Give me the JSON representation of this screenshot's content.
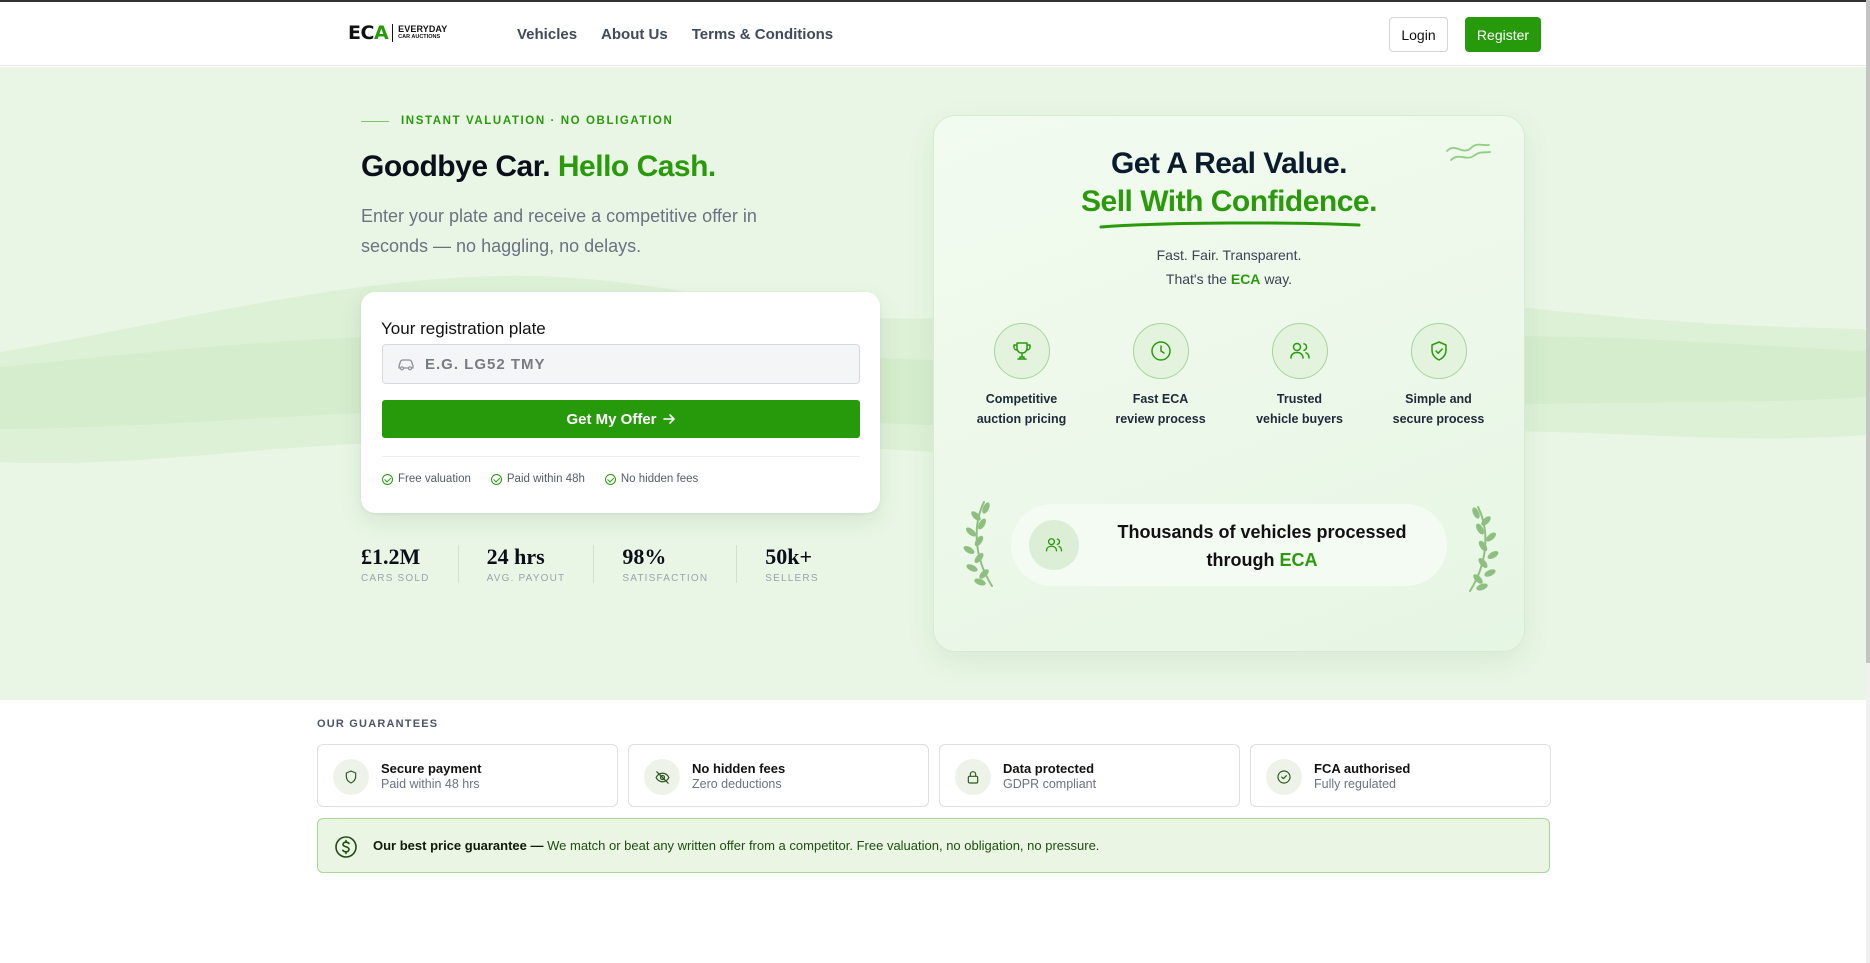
{
  "header": {
    "logo_mark_1": "EC",
    "logo_mark_2": "A",
    "logo_line1": "EVERYDAY",
    "logo_line2": "CAR AUCTIONS",
    "nav": [
      "Vehicles",
      "About Us",
      "Terms & Conditions"
    ],
    "login_label": "Login",
    "register_label": "Register"
  },
  "hero": {
    "eyebrow": "INSTANT VALUATION · NO OBLIGATION",
    "title_part1": "Goodbye Car.",
    "title_part2": "Hello Cash.",
    "subtitle": "Enter your plate and receive a competitive offer in seconds — no haggling, no delays.",
    "plate_label": "Your registration plate",
    "plate_placeholder": "E.G. LG52 TMY",
    "plate_value": "",
    "offer_button": "Get My Offer",
    "perks": [
      "Free valuation",
      "Paid within 48h",
      "No hidden fees"
    ],
    "stats": [
      {
        "value": "£1.2M",
        "label": "CARS SOLD"
      },
      {
        "value": "24 hrs",
        "label": "AVG. PAYOUT"
      },
      {
        "value": "98%",
        "label": "SATISFACTION"
      },
      {
        "value": "50k+",
        "label": "SELLERS"
      }
    ]
  },
  "value_card": {
    "title_line1": "Get A Real Value.",
    "title_line2": "Sell With Confidence.",
    "sub_line1": "Fast. Fair. Transparent.",
    "sub_line2_pre": "That's the",
    "sub_line2_brand": "ECA",
    "sub_line2_post": "way.",
    "features": [
      {
        "icon": "trophy-icon",
        "line1": "Competitive",
        "line2": "auction pricing"
      },
      {
        "icon": "clock-icon",
        "line1": "Fast ECA",
        "line2": "review process"
      },
      {
        "icon": "users-icon",
        "line1": "Trusted",
        "line2": "vehicle buyers"
      },
      {
        "icon": "shield-check-icon",
        "line1": "Simple and",
        "line2": "secure process"
      }
    ],
    "badge_line1": "Thousands of vehicles processed",
    "badge_line2_pre": "through",
    "badge_line2_brand": "ECA"
  },
  "guarantees": {
    "title": "OUR GUARANTEES",
    "items": [
      {
        "icon": "shield-icon",
        "title": "Secure payment",
        "sub": "Paid within 48 hrs"
      },
      {
        "icon": "eye-off-icon",
        "title": "No hidden fees",
        "sub": "Zero deductions"
      },
      {
        "icon": "lock-icon",
        "title": "Data protected",
        "sub": "GDPR compliant"
      },
      {
        "icon": "check-circle-icon",
        "title": "FCA authorised",
        "sub": "Fully regulated"
      }
    ],
    "banner_bold": "Our best price guarantee —",
    "banner_text": " We match or beat any written offer from a competitor. Free valuation, no obligation, no pressure."
  },
  "colors": {
    "brand_green": "#279a0b",
    "hero_bg": "#e9f6e5",
    "text_dark": "#0b0f19"
  }
}
